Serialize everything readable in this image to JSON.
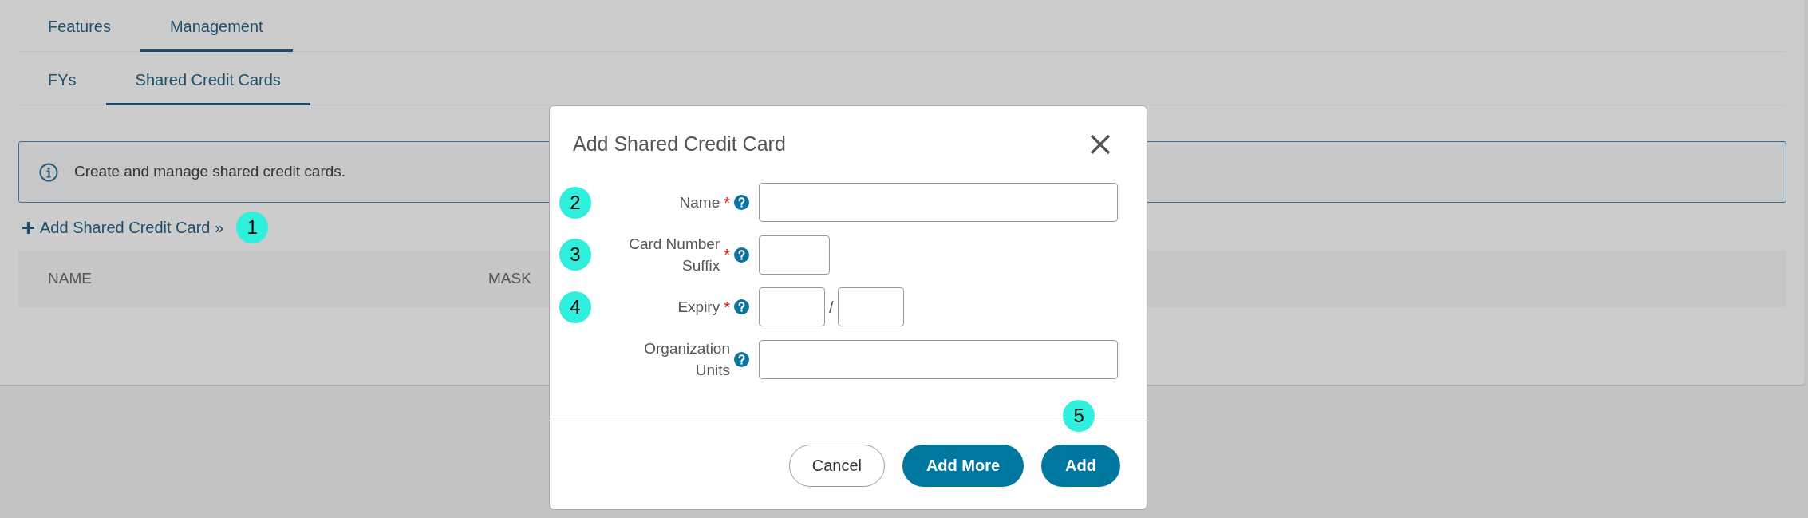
{
  "tabs": [
    {
      "label": "Features",
      "selected": false
    },
    {
      "label": "Management",
      "selected": true
    }
  ],
  "subtabs": [
    {
      "label": "FYs",
      "selected": false
    },
    {
      "label": "Shared Credit Cards",
      "selected": true
    }
  ],
  "info": {
    "text": "Create and manage shared credit cards."
  },
  "add_link": {
    "label": "Add Shared Credit Card »",
    "marker": "1"
  },
  "table": {
    "columns": [
      "NAME",
      "MASK"
    ]
  },
  "dialog": {
    "title": "Add Shared Credit Card",
    "fields": [
      {
        "label": "Name",
        "required_mark": "*",
        "kind": "wide",
        "marker": "2"
      },
      {
        "label": "Card Number Suffix",
        "required_mark": "*",
        "kind": "short",
        "marker": "3"
      },
      {
        "label": "Expiry",
        "required_mark": "*",
        "kind": "pair",
        "separator": "/",
        "marker": "4"
      },
      {
        "label": "Organization Units",
        "kind": "wide"
      }
    ],
    "buttons": [
      {
        "label": "Cancel",
        "kind": "outline"
      },
      {
        "label": "Add More",
        "kind": "primary"
      },
      {
        "label": "Add",
        "kind": "primary",
        "marker": "5"
      }
    ]
  }
}
